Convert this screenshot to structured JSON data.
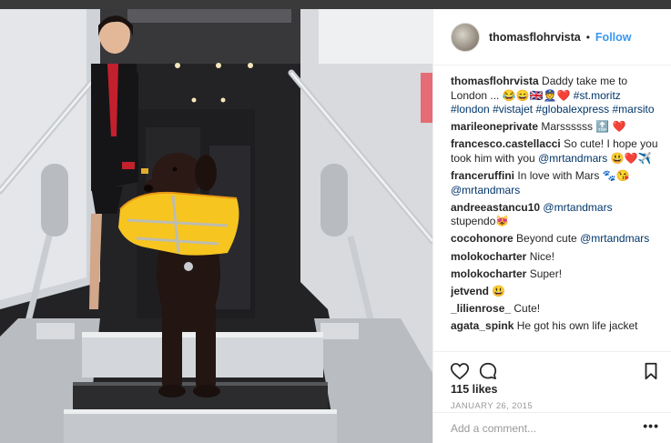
{
  "post": {
    "username": "thomasflohrvista",
    "follow_label": "Follow",
    "separator": "•",
    "likes": "115 likes",
    "date": "JANUARY 26, 2015",
    "add_comment_placeholder": "Add a comment...",
    "more_label": "•••"
  },
  "caption": {
    "user": "thomasflohrvista",
    "text": "Daddy take me to London ... 😂😄🇬🇧👮❤️",
    "tags": [
      "#st.moritz",
      "#london",
      "#vistajet",
      "#globalexpress",
      "#marsito"
    ]
  },
  "comments": [
    {
      "user": "marileoneprivate",
      "text": "Marssssss 🔝 ❤️"
    },
    {
      "user": "francesco.castellacci",
      "text": "So cute! I hope you took him with you",
      "mention": "@mrtandmars",
      "after": "😃❤️✈️"
    },
    {
      "user": "franceruffini",
      "text": "In love with Mars 🐾😘",
      "mention": "@mrtandmars",
      "after": ""
    },
    {
      "user": "andreeastancu10",
      "text": "",
      "mention": "@mrtandmars",
      "after": "stupendo😻"
    },
    {
      "user": "cocohonore",
      "text": "Beyond cute",
      "mention": "@mrtandmars",
      "after": ""
    },
    {
      "user": "molokocharter",
      "text": "Nice!"
    },
    {
      "user": "molokocharter",
      "text": "Super!"
    },
    {
      "user": "jetvend",
      "text": "😃"
    },
    {
      "user": "_lilienrose_",
      "text": "Cute!"
    },
    {
      "user": "agata_spink",
      "text": "He got his own life jacket"
    }
  ],
  "icons": {
    "like": "heart-icon",
    "comment": "comment-icon",
    "save": "bookmark-icon",
    "avatar": "avatar"
  },
  "colors": {
    "link": "#3897f0",
    "hashtag": "#003569",
    "vest": "#f7c520",
    "uniform_red": "#c3202e"
  }
}
